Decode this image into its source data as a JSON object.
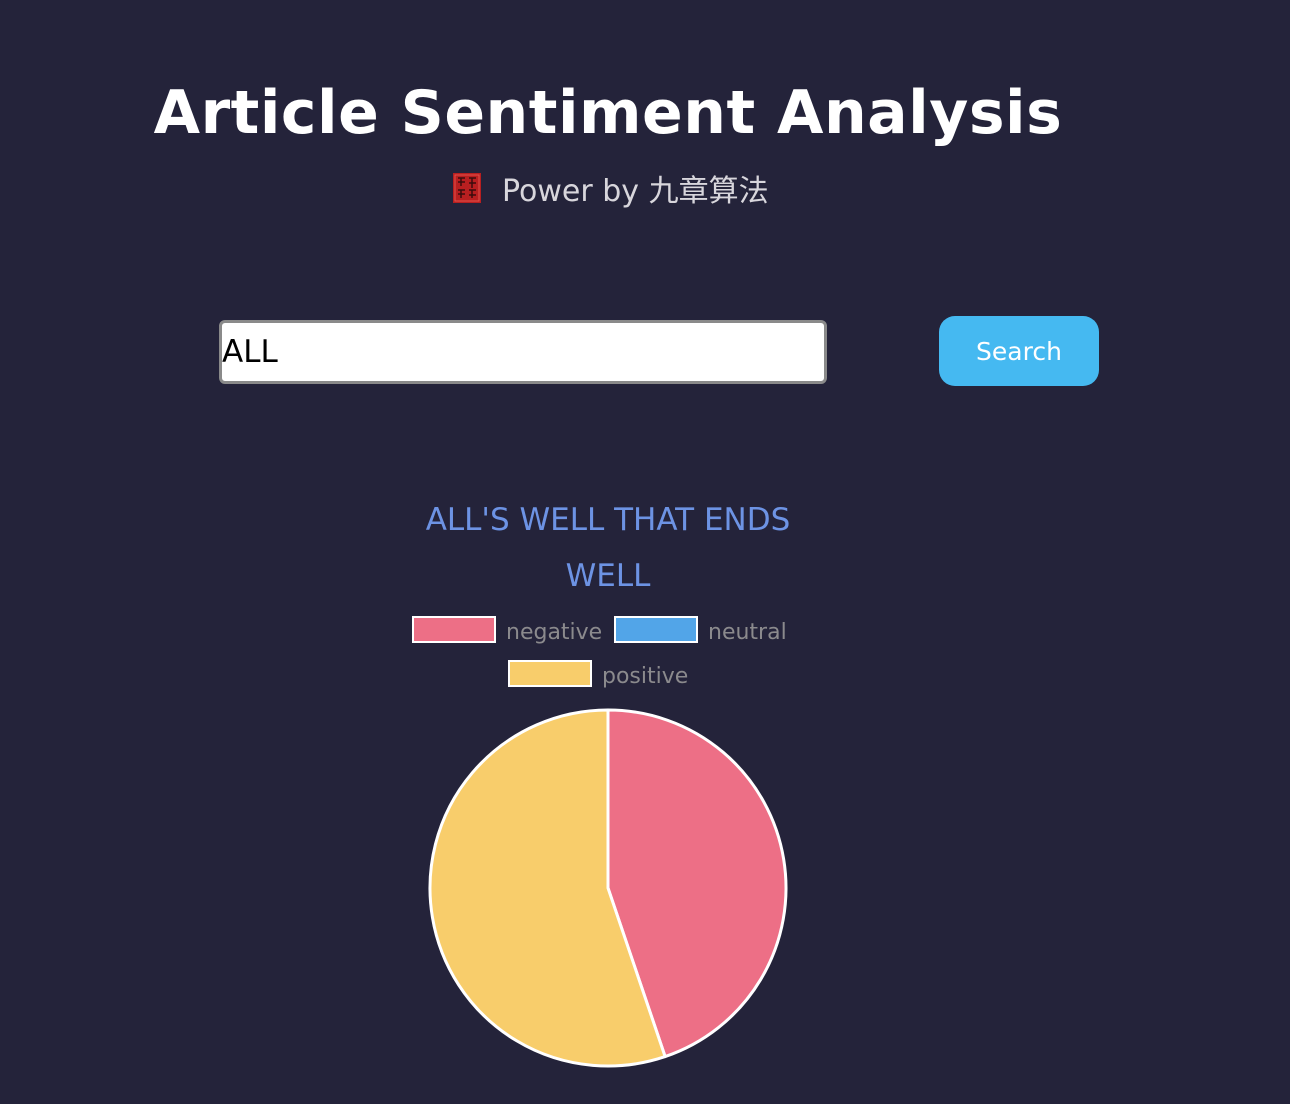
{
  "header": {
    "title": "Article Sentiment Analysis",
    "subtitle": "Power by 九章算法",
    "seal_icon": "red-seal-stamp-logo"
  },
  "search": {
    "value": "ALL",
    "button_label": "Search",
    "button_color": "#45b9f1"
  },
  "chart": {
    "title_line1": "ALL'S WELL THAT ENDS",
    "title_line2": "WELL"
  },
  "chart_data": {
    "type": "pie",
    "title": "ALL'S WELL THAT ENDS WELL",
    "categories": [
      "negative",
      "neutral",
      "positive"
    ],
    "values": [
      44.8,
      0,
      55.2
    ],
    "colors": [
      "#ed6f86",
      "#52a5e8",
      "#f8cd6b"
    ],
    "legend_position": "top"
  },
  "theme": {
    "background": "#24233a",
    "title_color": "#ffffff",
    "chart_title_color": "#6d93e4"
  }
}
